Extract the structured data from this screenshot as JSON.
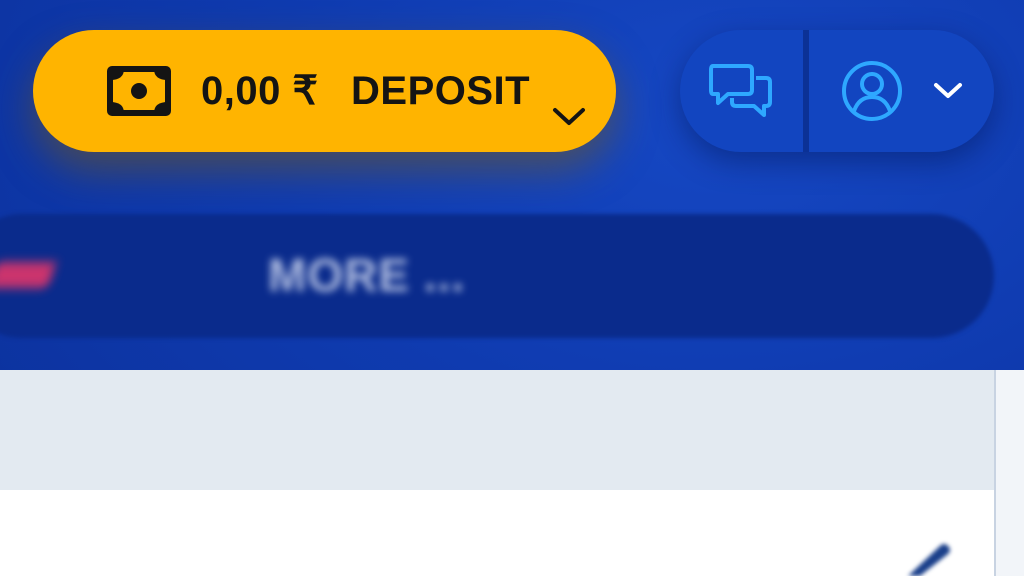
{
  "header": {
    "balance": "0,00 ₹",
    "deposit_label": "DEPOSIT",
    "icons": {
      "wallet": "money-bill-icon",
      "deposit_dropdown": "chevron-down-icon",
      "chat": "chat-bubbles-icon",
      "profile": "user-circle-icon",
      "profile_dropdown": "chevron-down-icon"
    }
  },
  "nav": {
    "more_label": "MORE ..."
  },
  "colors": {
    "background": "#0f3bb0",
    "deposit_button": "#ffb400",
    "controls_pill": "#1245c0",
    "icon_accent": "#2ea8ff",
    "nav_bar": "#0a2b8c",
    "nav_accent": "#e0356a",
    "panel_top": "#e3eaf1",
    "panel_bottom": "#ffffff"
  }
}
